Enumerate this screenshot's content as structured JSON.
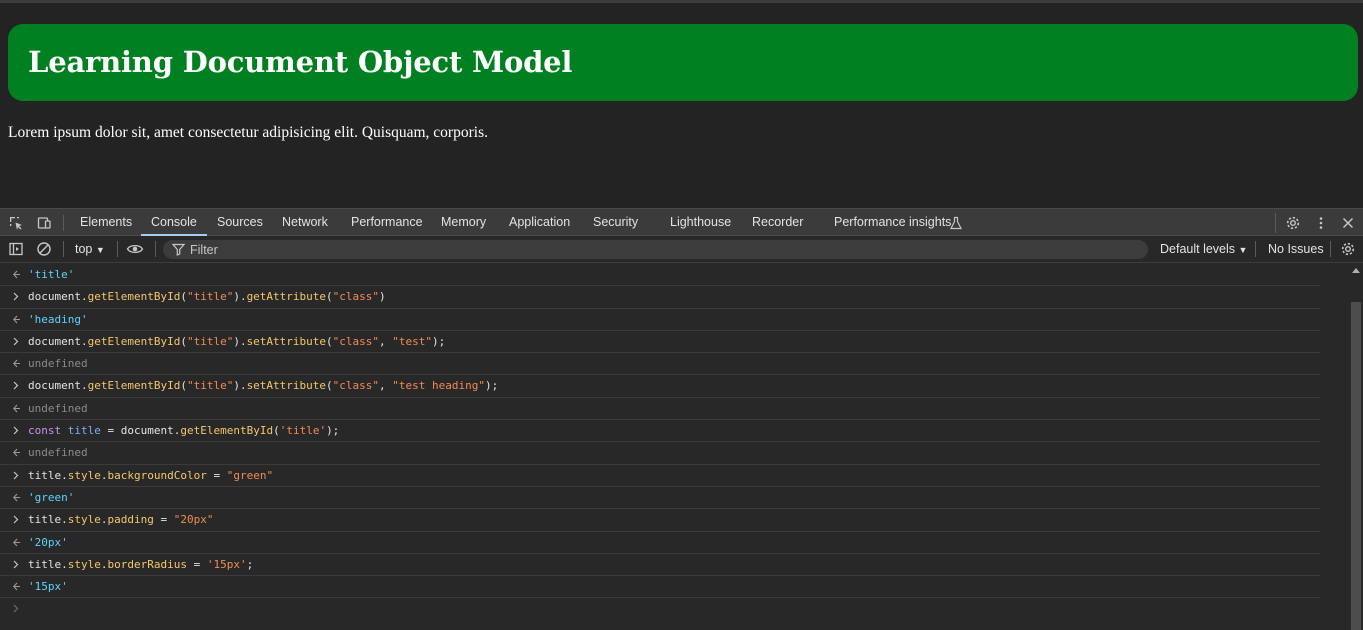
{
  "page": {
    "heading": "Learning Document Object Model",
    "paragraph": "Lorem ipsum dolor sit, amet consectetur adipisicing elit. Quisquam, corporis.",
    "heading_bg": "#008020"
  },
  "devtools": {
    "tabs": [
      {
        "label": "Elements"
      },
      {
        "label": "Console",
        "active": true
      },
      {
        "label": "Sources"
      },
      {
        "label": "Network"
      },
      {
        "label": "Performance"
      },
      {
        "label": "Memory"
      },
      {
        "label": "Application"
      },
      {
        "label": "Security"
      },
      {
        "label": "Lighthouse"
      },
      {
        "label": "Recorder"
      },
      {
        "label": "Performance insights"
      }
    ],
    "toolbar": {
      "context": "top",
      "filter_placeholder": "Filter",
      "levels": "Default levels",
      "issues": "No Issues"
    },
    "console": [
      {
        "kind": "out",
        "type": "res",
        "text": "'title'"
      },
      {
        "kind": "in",
        "text": "document.getElementById(\"title\").getAttribute(\"class\")"
      },
      {
        "kind": "out",
        "type": "res",
        "text": "'heading'"
      },
      {
        "kind": "in",
        "text": "document.getElementById(\"title\").setAttribute(\"class\", \"test\");"
      },
      {
        "kind": "out",
        "type": "undef",
        "text": "undefined"
      },
      {
        "kind": "in",
        "text": "document.getElementById(\"title\").setAttribute(\"class\", \"test heading\");"
      },
      {
        "kind": "out",
        "type": "undef",
        "text": "undefined"
      },
      {
        "kind": "in",
        "text": "const title = document.getElementById('title');"
      },
      {
        "kind": "out",
        "type": "undef",
        "text": "undefined"
      },
      {
        "kind": "in",
        "text": "title.style.backgroundColor = \"green\""
      },
      {
        "kind": "out",
        "type": "res",
        "text": "'green'"
      },
      {
        "kind": "in",
        "text": "title.style.padding = \"20px\""
      },
      {
        "kind": "out",
        "type": "res",
        "text": "'20px'"
      },
      {
        "kind": "in",
        "text": "title.style.borderRadius = '15px';"
      },
      {
        "kind": "out",
        "type": "res",
        "text": "'15px'"
      }
    ]
  }
}
